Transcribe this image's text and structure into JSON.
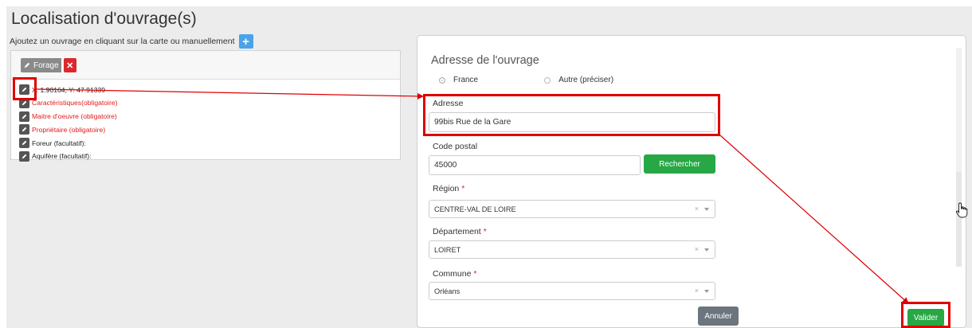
{
  "page": {
    "title": "Localisation d'ouvrage(s)",
    "hint": "Ajoutez un ouvrage en cliquant sur la carte ou manuellement",
    "add_button_icon": "plus-icon"
  },
  "tree": {
    "root_label": "Forage",
    "delete_icon": "close-icon",
    "items": [
      {
        "label": "X: 1.90164, Y: 47.91339",
        "style": "normal"
      },
      {
        "label": "Caractéristiques(obligatoire)",
        "style": "required"
      },
      {
        "label": "Maitre d'oeuvre (obligatoire)",
        "style": "required"
      },
      {
        "label": "Propriétaire (obligatoire)",
        "style": "required"
      },
      {
        "label": "Foreur (facultatif):",
        "style": "normal"
      },
      {
        "label": "Aquifère (facultatif):",
        "style": "normal"
      }
    ]
  },
  "modal": {
    "title": "Adresse de l'ouvrage",
    "radio": {
      "option1": "France",
      "option2": "Autre (préciser)",
      "selected": "France"
    },
    "adresse": {
      "label": "Adresse",
      "value": "99bis Rue de la Gare"
    },
    "code_postal": {
      "label": "Code postal",
      "value": "45000"
    },
    "rechercher_label": "Rechercher",
    "region": {
      "label": "Région",
      "value": "CENTRE-VAL DE LOIRE"
    },
    "departement": {
      "label": "Département",
      "value": "LOIRET"
    },
    "commune": {
      "label": "Commune",
      "value": "Orléans"
    },
    "required_mark": "*",
    "clear_glyph": "×",
    "annuler_label": "Annuler",
    "valider_label": "Valider"
  },
  "colors": {
    "annotation_red": "#e00000",
    "success_green": "#28a745",
    "primary_blue": "#4aa3e8",
    "danger_red": "#d9292f",
    "secondary_gray": "#6c757d"
  }
}
